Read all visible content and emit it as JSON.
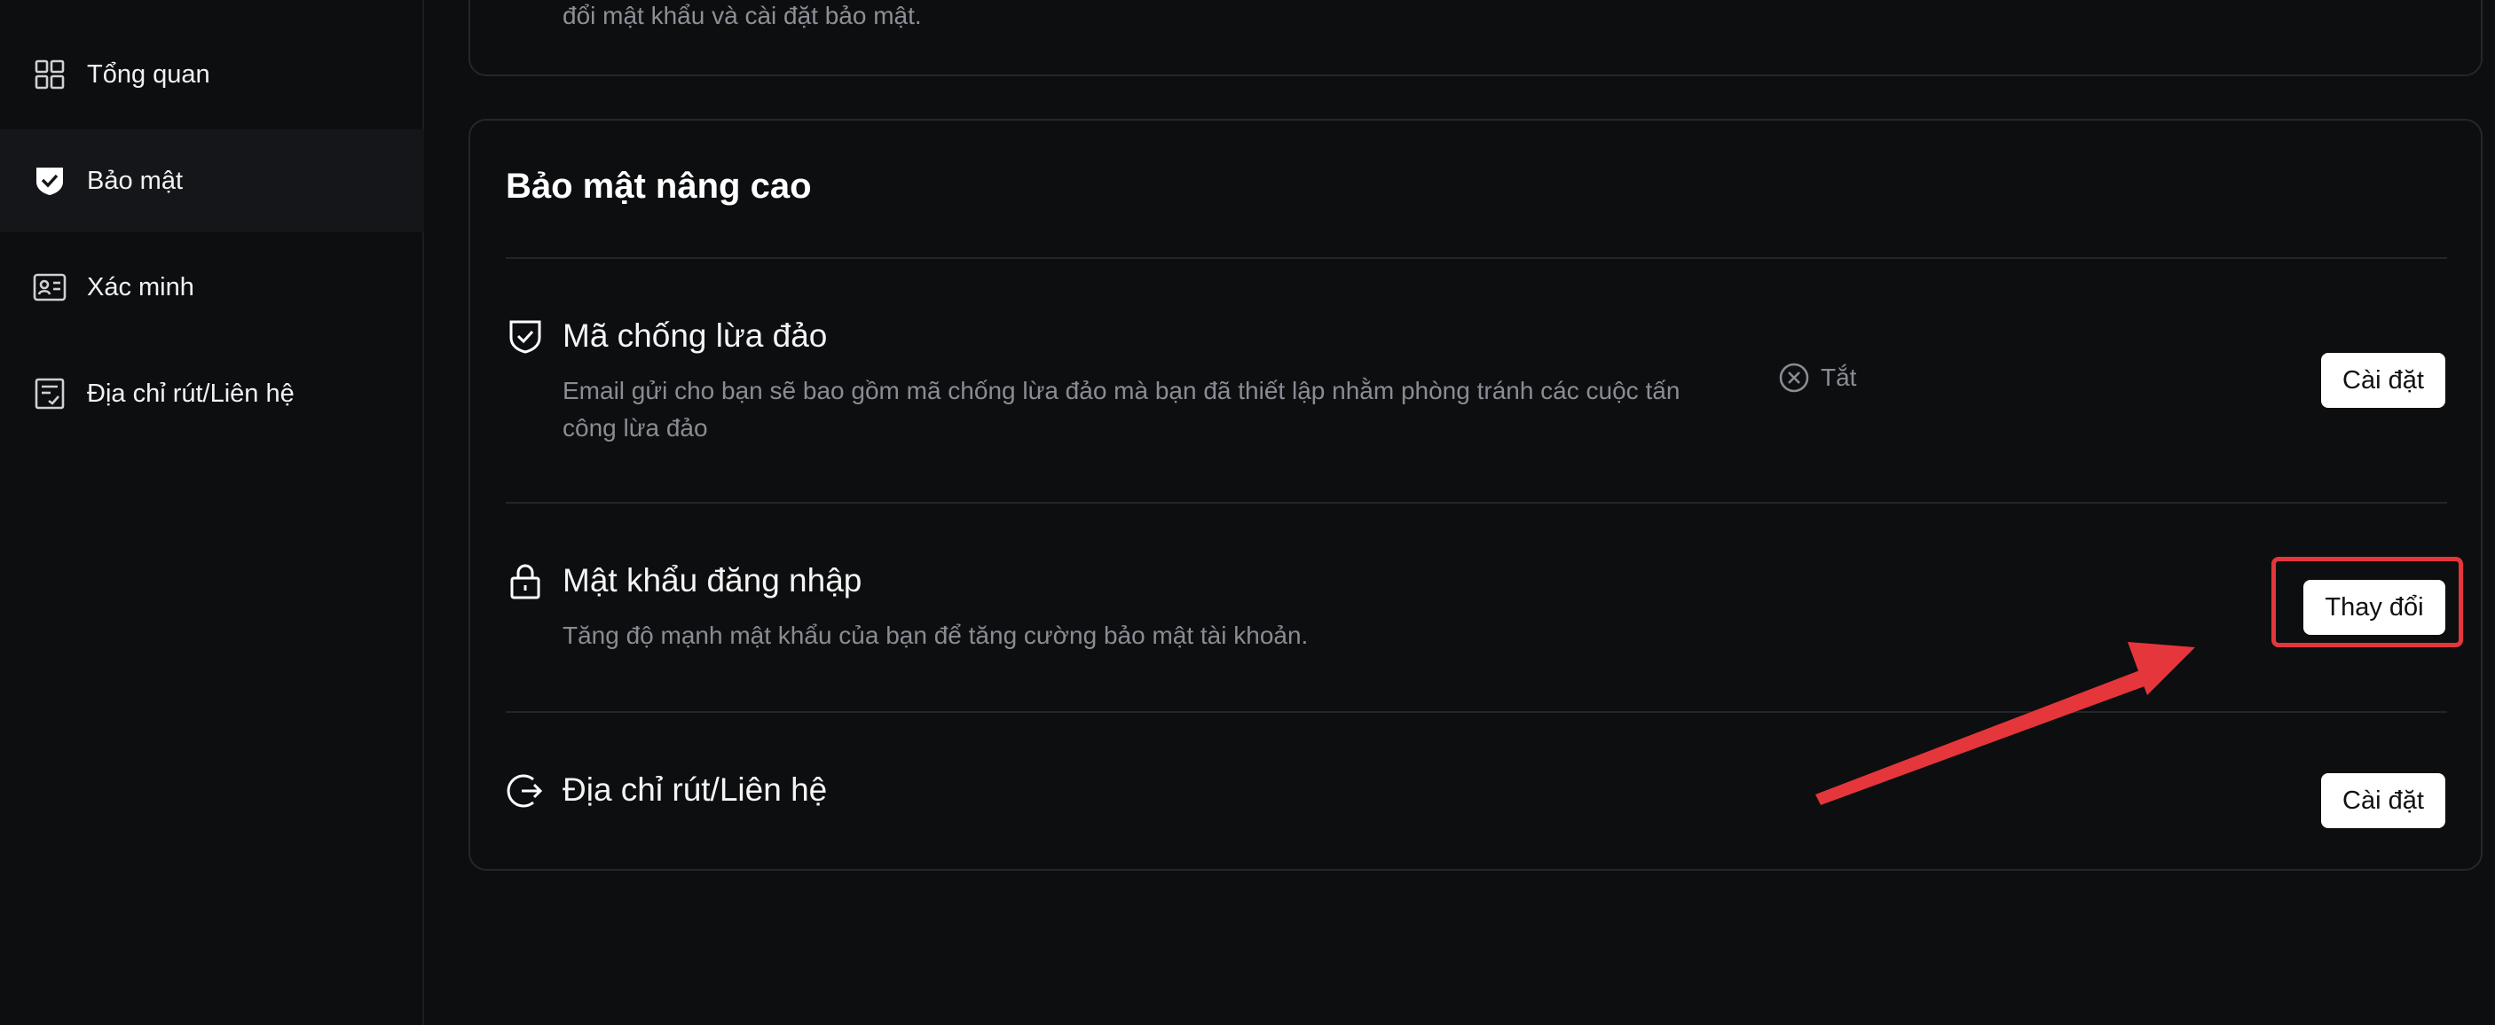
{
  "sidebar": {
    "items": [
      {
        "label": "Tổng quan",
        "icon": "dashboard-grid-icon"
      },
      {
        "label": "Bảo mật",
        "icon": "shield-check-icon",
        "active": true
      },
      {
        "label": "Xác minh",
        "icon": "id-card-icon"
      },
      {
        "label": "Địa chỉ rút/Liên hệ",
        "icon": "address-list-icon"
      }
    ]
  },
  "top_card": {
    "desc": "đổi mật khẩu và cài đặt bảo mật."
  },
  "advanced_security": {
    "title": "Bảo mật nâng cao",
    "rows": [
      {
        "title": "Mã chống lừa đảo",
        "desc": "Email gửi cho bạn sẽ bao gồm mã chống lừa đảo mà bạn đã thiết lập nhằm phòng tránh các cuộc tấn công lừa đảo",
        "status": "Tắt",
        "button": "Cài đặt",
        "icon": "shield-check-outline-icon"
      },
      {
        "title": "Mật khẩu đăng nhập",
        "desc": "Tăng độ mạnh mật khẩu của bạn để tăng cường bảo mật tài khoản.",
        "button": "Thay đổi",
        "icon": "lock-icon"
      },
      {
        "title": "Địa chỉ rút/Liên hệ",
        "button": "Cài đặt",
        "icon": "withdraw-arrow-icon"
      }
    ]
  },
  "colors": {
    "background": "#0d0e10",
    "highlight": "#e5363b",
    "button_bg": "#ffffff",
    "muted_text": "#8a8c93"
  }
}
